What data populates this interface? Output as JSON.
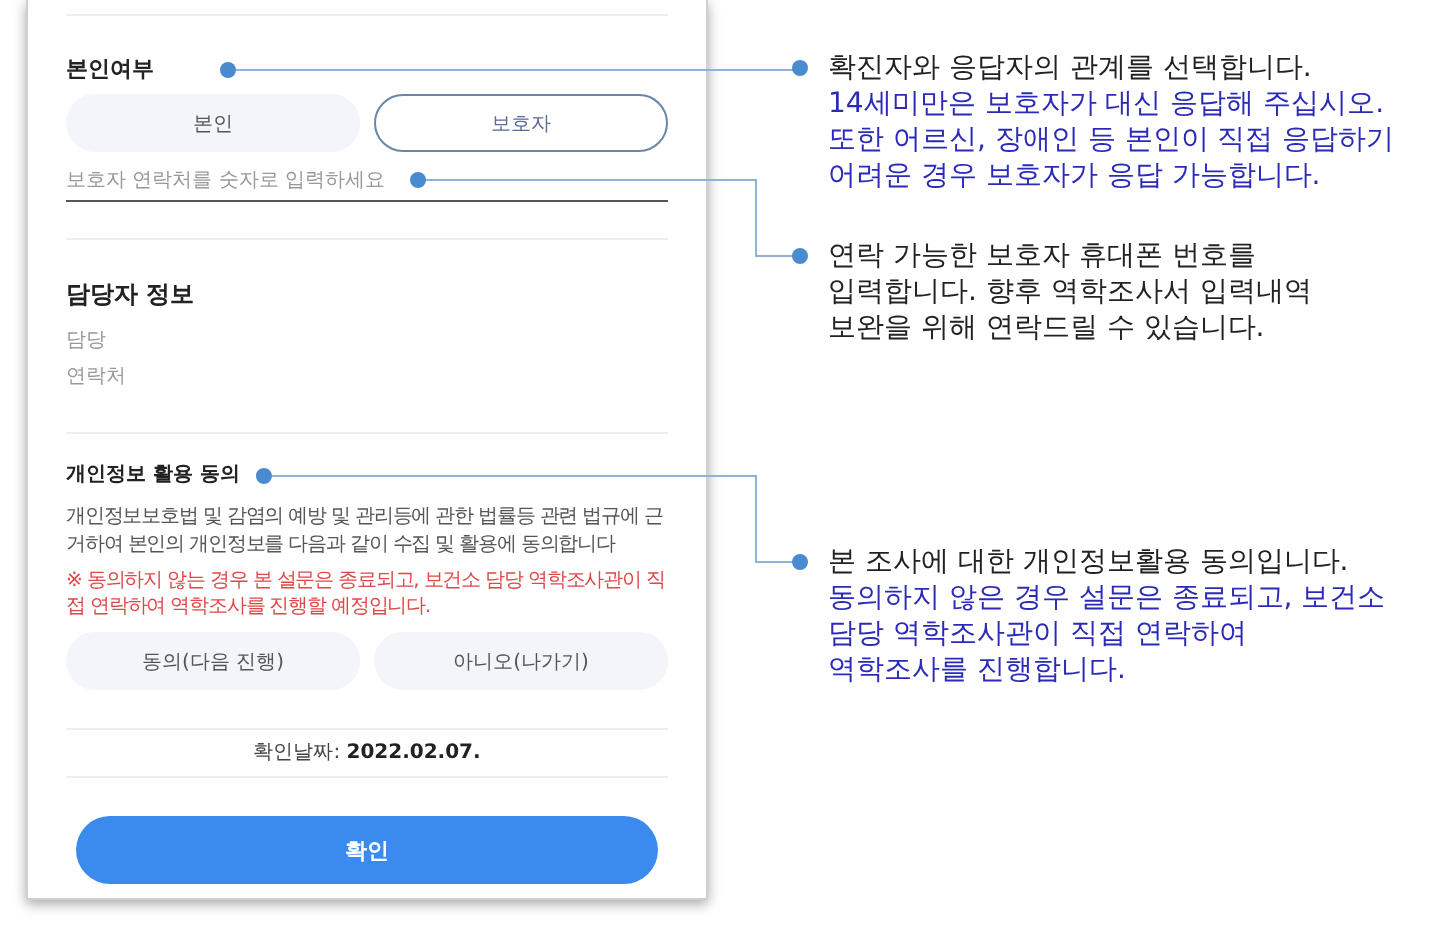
{
  "form": {
    "identity_section": {
      "title": "본인여부",
      "options": [
        {
          "label": "본인",
          "selected": false
        },
        {
          "label": "보호자",
          "selected": true
        }
      ],
      "phone_field": {
        "placeholder": "보호자 연락처를 숫자로 입력하세요"
      }
    },
    "staff_section": {
      "title": "담당자 정보",
      "fields": [
        "담당",
        "연락처"
      ]
    },
    "consent_section": {
      "title": "개인정보 활용 동의",
      "description": "개인정보보호법 및 감염의 예방 및 관리등에 관한 법률등 관련 법규에 근거하여 본인의 개인정보를 다음과 같이 수집 및 활용에 동의합니다",
      "warning": "※ 동의하지 않는 경우 본 설문은 종료되고, 보건소 담당 역학조사관이 직접 연락하여 역학조사를 진행할 예정입니다.",
      "options": [
        {
          "label": "동의(다음 진행)",
          "selected": false
        },
        {
          "label": "아니오(나가기)",
          "selected": false
        }
      ]
    },
    "confirm_date": "확인날짜: **2022.02.07.**",
    "confirm_button": "확인"
  },
  "annotations": [
    {
      "lines": [
        {
          "text": "확진자와 응답자의 관계를 선택합니다.",
          "kind": "plain"
        },
        {
          "text": "14세미만은 보호자가 대신 응답해 주십시오.",
          "kind": "emphasis"
        },
        {
          "text": "또한 어르신, 장애인 등 본인이 직접 응답하기",
          "kind": "emphasis"
        },
        {
          "text": "어려운 경우 보호자가 응답 가능합니다.",
          "kind": "emphasis"
        }
      ]
    },
    {
      "lines": [
        {
          "text": "연락 가능한 보호자 휴대폰 번호를",
          "kind": "plain"
        },
        {
          "text": "입력합니다. 향후 역학조사서 입력내역",
          "kind": "plain"
        },
        {
          "text": "보완을 위해 연락드릴 수 있습니다.",
          "kind": "plain"
        }
      ]
    },
    {
      "lines": [
        {
          "text": "본 조사에 대한 개인정보활용 동의입니다.",
          "kind": "plain"
        },
        {
          "text": "동의하지 않은 경우 설문은 종료되고, 보건소",
          "kind": "emphasis"
        },
        {
          "text": "담당 역학조사관이 직접 연락하여",
          "kind": "emphasis"
        },
        {
          "text": "역학조사를 진행합니다.",
          "kind": "emphasis"
        }
      ]
    }
  ]
}
